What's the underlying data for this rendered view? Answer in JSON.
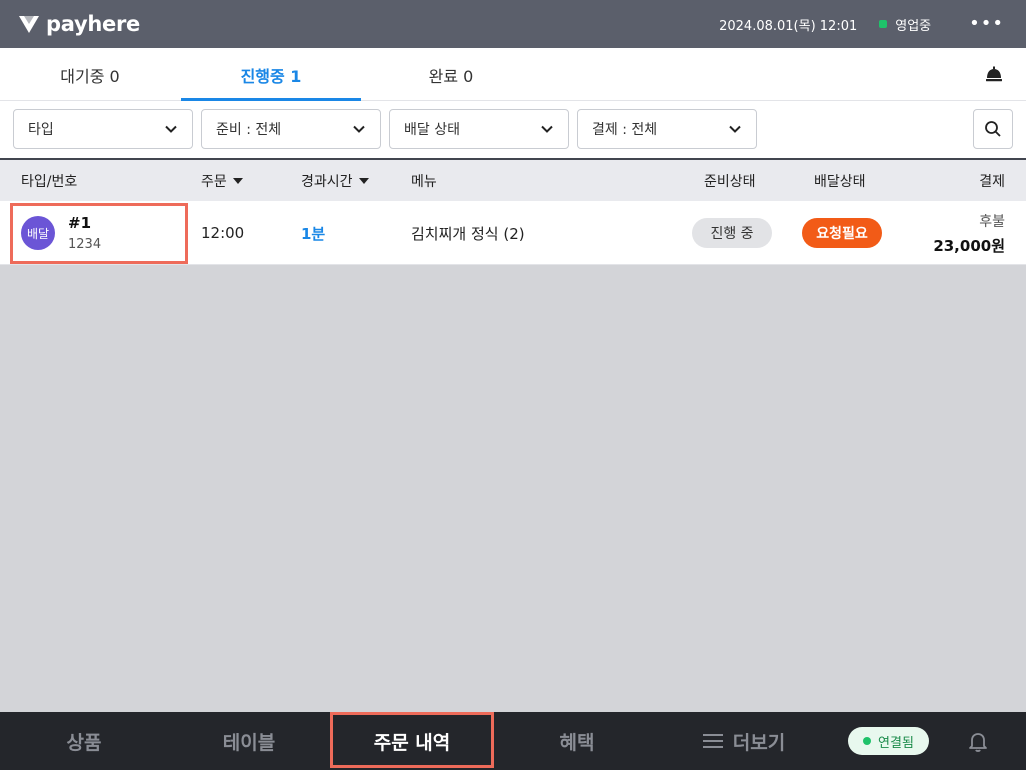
{
  "header": {
    "brand": "payhere",
    "datetime": "2024.08.01(목) 12:01",
    "status": "영업중",
    "more": "•••",
    "colors": {
      "bar": "#5b5f6b",
      "status_dot": "#1fc26a"
    }
  },
  "tabs": [
    {
      "label": "대기중 0"
    },
    {
      "label": "진행중 1",
      "active": true
    },
    {
      "label": "완료 0"
    }
  ],
  "filters": [
    {
      "label": "타입"
    },
    {
      "label": "준비 : 전체"
    },
    {
      "label": "배달 상태"
    },
    {
      "label": "결제 : 전체"
    }
  ],
  "table": {
    "headers": {
      "type_no": "타입/번호",
      "order": "주문",
      "elapsed": "경과시간",
      "menu": "메뉴",
      "prep_status": "준비상태",
      "delivery_status": "배달상태",
      "payment": "결제"
    },
    "rows": [
      {
        "type": "배달",
        "number": "#1",
        "code": "1234",
        "order_time": "12:00",
        "elapsed": "1분",
        "menu": "김치찌개 정식 (2)",
        "prep_status": "진행 중",
        "delivery_status": "요청필요",
        "payment_type": "후불",
        "amount": "23,000원"
      }
    ]
  },
  "bottom_nav": {
    "items": [
      {
        "label": "상품"
      },
      {
        "label": "테이블"
      },
      {
        "label": "주문 내역",
        "active": true
      },
      {
        "label": "혜택"
      },
      {
        "label": "더보기"
      }
    ],
    "connection": "연결됨"
  },
  "icons": [
    "payhere-logo-icon",
    "bell-icon",
    "chevron-down-icon",
    "search-icon",
    "menu-icon",
    "notification-bell-icon"
  ]
}
